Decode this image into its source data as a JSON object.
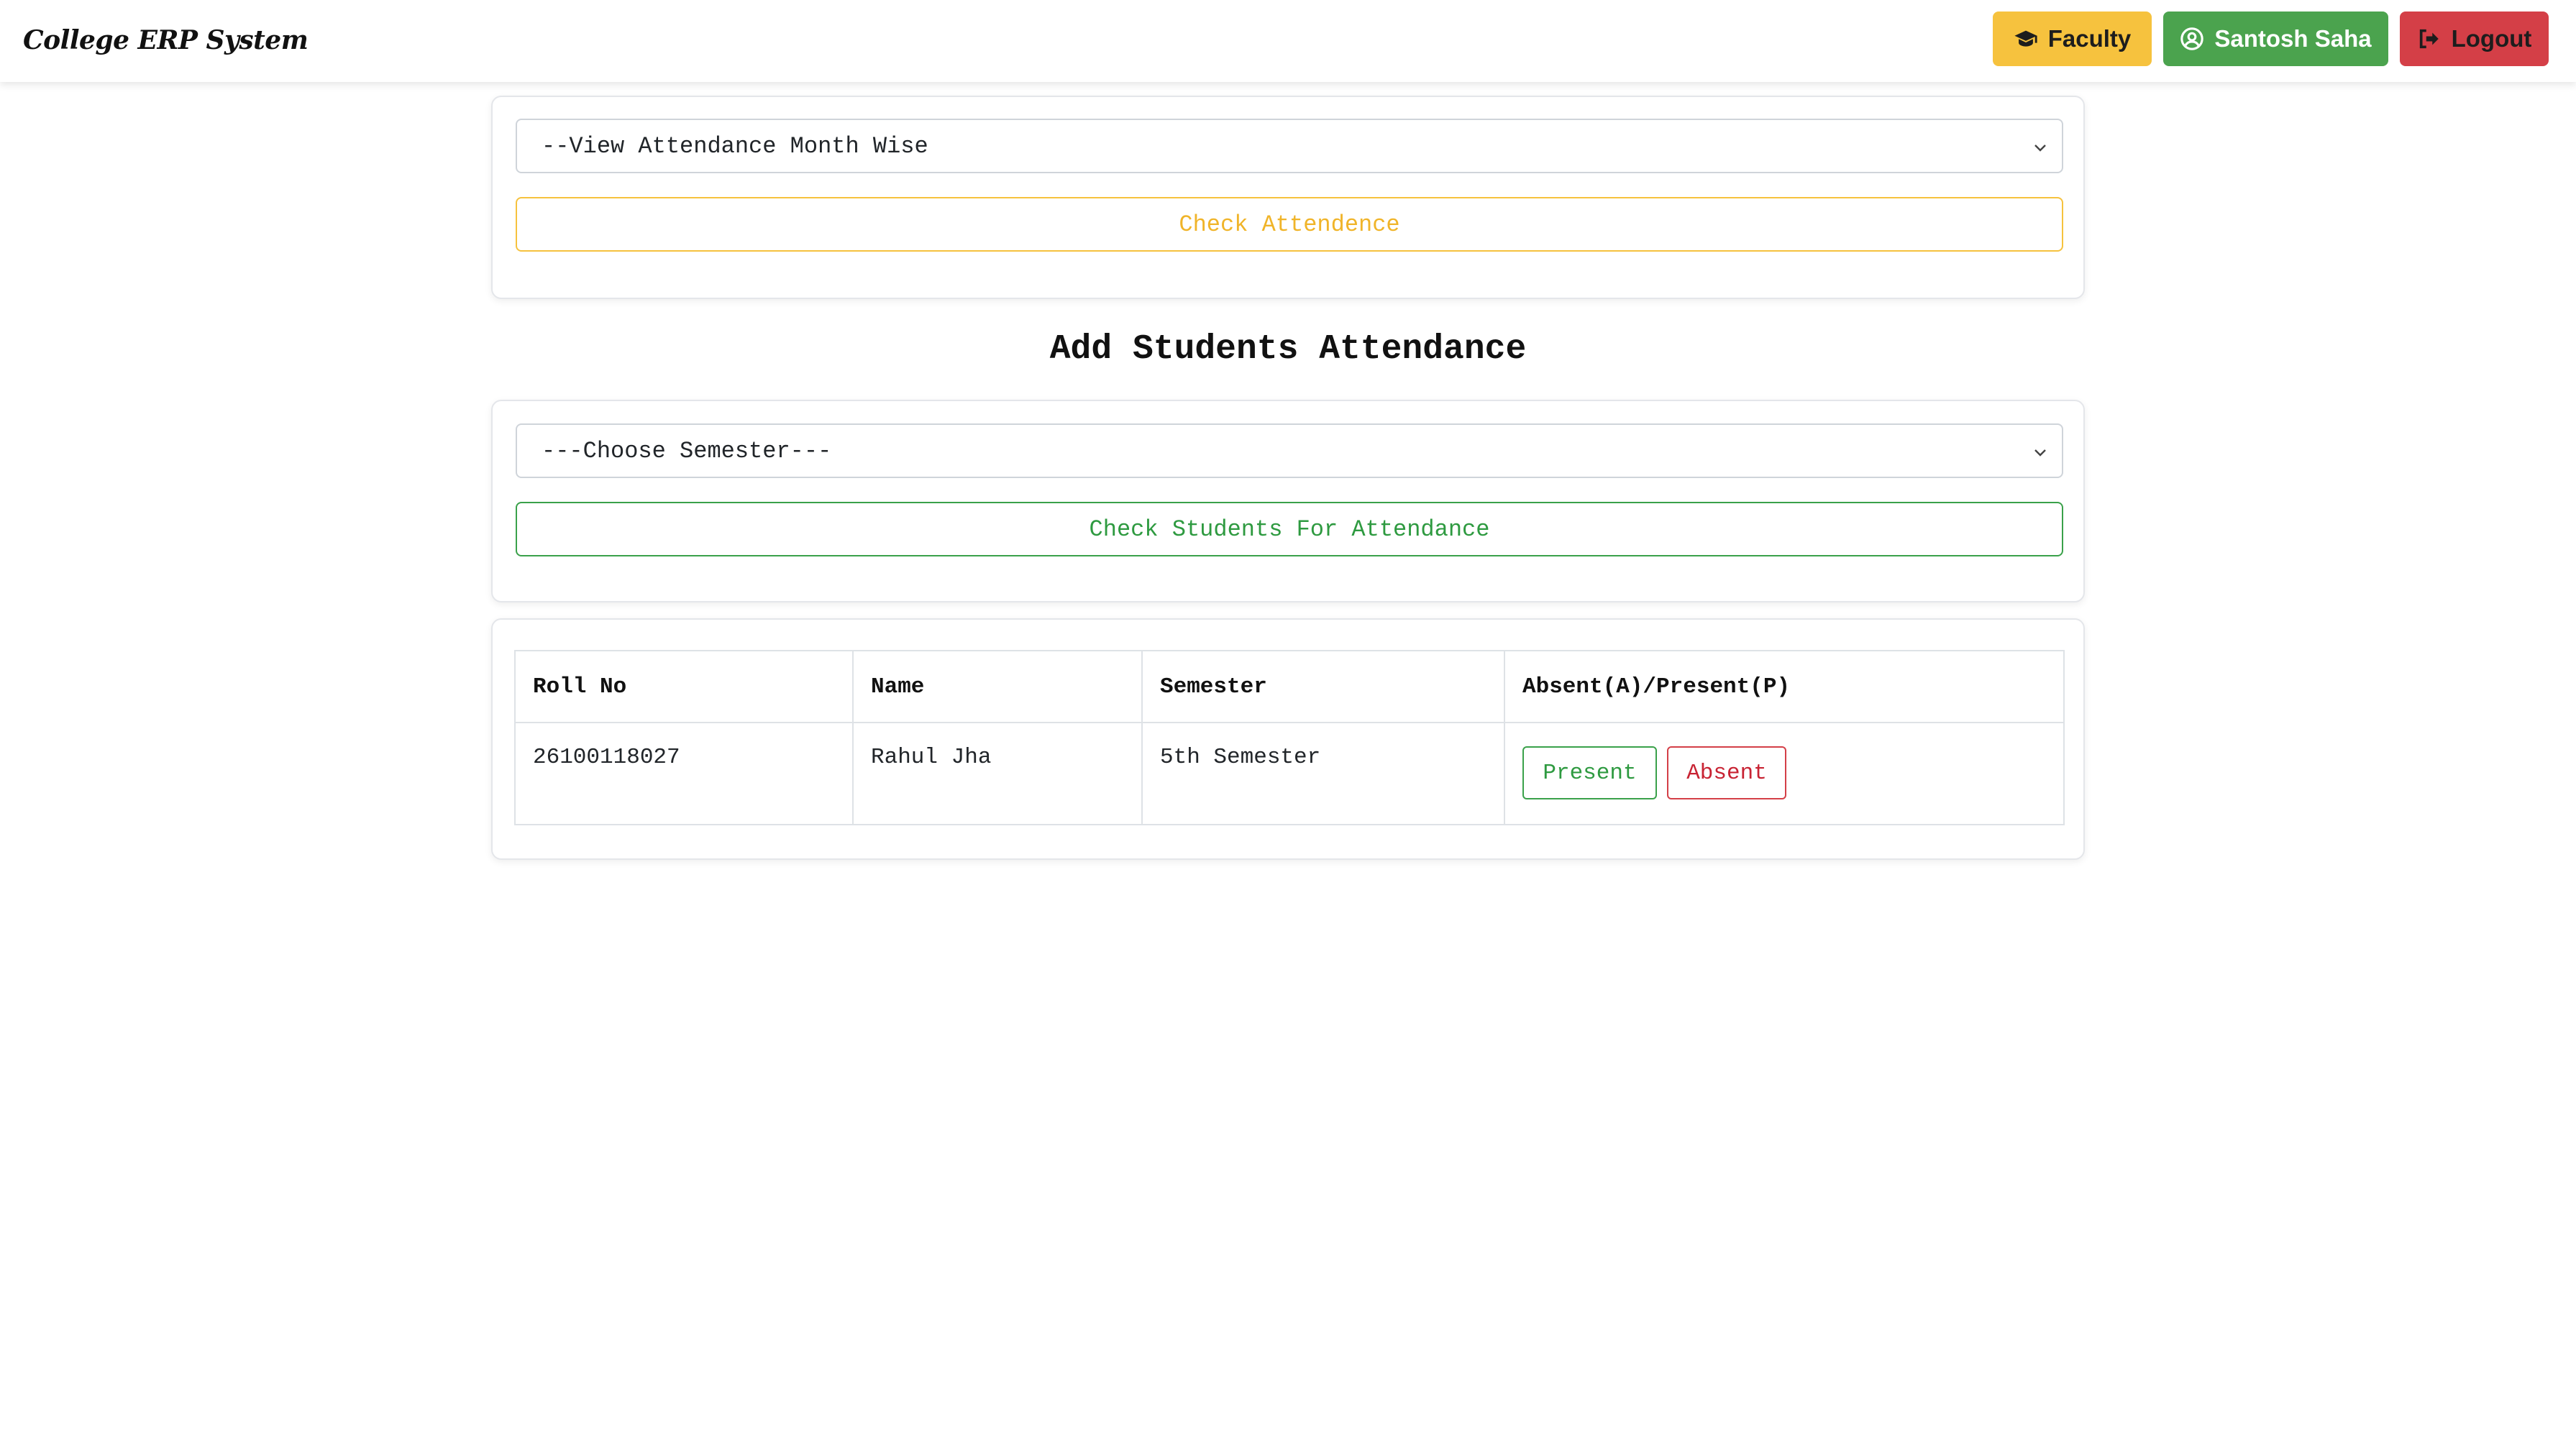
{
  "app": {
    "title": "College ERP System"
  },
  "nav": {
    "faculty_label": "Faculty",
    "user_label": "Santosh Saha",
    "logout_label": "Logout"
  },
  "month_view": {
    "select_value": "--View Attendance Month Wise",
    "button_label": "Check Attendence"
  },
  "add_attendance": {
    "title": "Add Students Attendance",
    "select_value": "---Choose Semester---",
    "button_label": "Check Students For Attendance"
  },
  "table": {
    "headers": [
      "Roll No",
      "Name",
      "Semester",
      "Absent(A)/Present(P)"
    ],
    "rows": [
      {
        "roll": "26100118027",
        "name": "Rahul Jha",
        "semester": "5th Semester",
        "present_label": "Present",
        "absent_label": "Absent"
      }
    ]
  },
  "colors": {
    "warning": "#f6c23e",
    "success": "#4ba34e",
    "danger": "#d43f47"
  },
  "icons": {
    "faculty": "graduation-cap-icon",
    "user": "user-circle-icon",
    "logout": "sign-out-icon",
    "select_caret": "chevron-down-icon"
  }
}
